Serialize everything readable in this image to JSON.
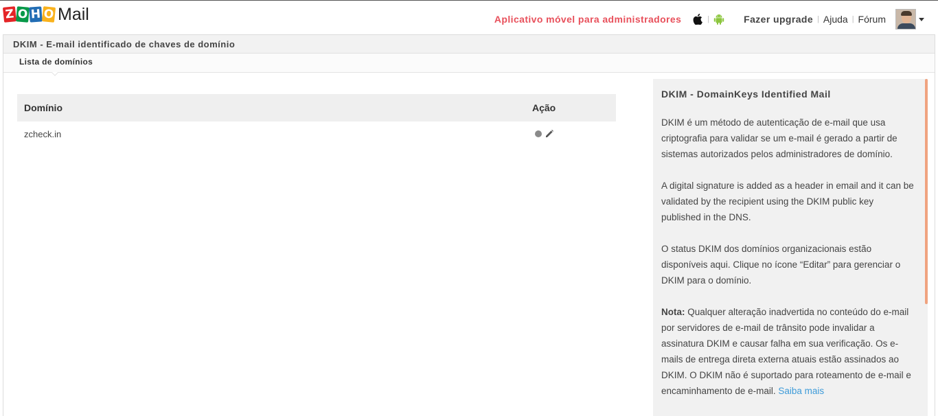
{
  "header": {
    "logo_letters": [
      "Z",
      "O",
      "H",
      "O"
    ],
    "logo_text": "Mail",
    "mobile_admin_link": "Aplicativo móvel para administradores",
    "upgrade_label": "Fazer upgrade",
    "help_label": "Ajuda",
    "forum_label": "Fórum",
    "separator": "|"
  },
  "panel": {
    "title": "DKIM - E-mail identificado de chaves de domínio",
    "subtab": "Lista de domínios"
  },
  "table": {
    "headers": {
      "domain": "Domínio",
      "action": "Ação"
    },
    "rows": [
      {
        "domain": "zcheck.in"
      }
    ]
  },
  "info": {
    "title": "DKIM - DomainKeys Identified Mail",
    "para1": "DKIM é um método de autenticação de e-mail que usa criptografia para validar se um e-mail é gerado a partir de sistemas autorizados pelos administradores de domínio.",
    "para2": "A digital signature is added as a header in email and it can be validated by the recipient using the DKIM public key published in the DNS.",
    "para3": "O status DKIM dos domínios organizacionais estão disponíveis aqui. Clique no ícone “Editar” para gerenciar o DKIM para o domínio.",
    "nota_label": "Nota:",
    "nota_text": " Qualquer alteração inadvertida no conteúdo do e-mail por servidores de e-mail de trânsito pode invalidar a assinatura DKIM e causar falha em sua verificação. Os e-mails de entrega direta externa atuais estão assinados ao DKIM. O DKIM não é suportado para roteamento de e-mail e encaminhamento de e-mail. ",
    "learn_more": "Saiba mais"
  },
  "colors": {
    "accent_red": "#e8505b",
    "link_blue": "#3d9bd9",
    "android_green": "#8cc63e",
    "scroll_orange": "#f0a37f"
  },
  "icons": [
    "apple-icon",
    "android-icon",
    "status-dot-icon",
    "edit-pencil-icon",
    "user-avatar",
    "chevron-down-icon"
  ]
}
